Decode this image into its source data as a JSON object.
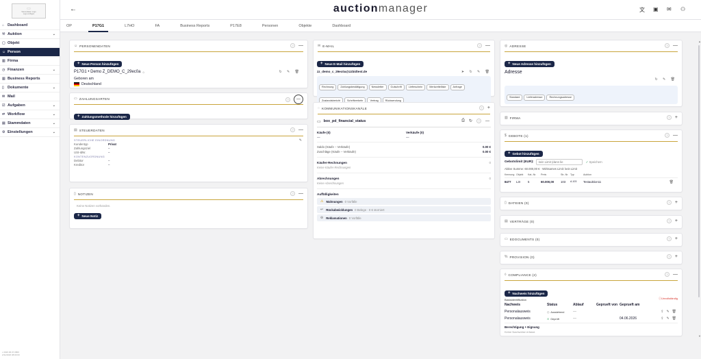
{
  "sidebar": {
    "logo_text": [
      "Stammdaten Logo",
      "Logo einfügen"
    ],
    "items": [
      {
        "label": "Dashboard",
        "icon": "home-icon",
        "chevron": false,
        "active": false
      },
      {
        "label": "Auktion",
        "icon": "gavel-icon",
        "chevron": true,
        "active": false
      },
      {
        "label": "Objekt",
        "icon": "box-icon",
        "chevron": false,
        "active": false
      },
      {
        "label": "Person",
        "icon": "person-icon",
        "chevron": false,
        "active": true
      },
      {
        "label": "Firma",
        "icon": "building-icon",
        "chevron": false,
        "active": false
      },
      {
        "label": "Finanzen",
        "icon": "finance-icon",
        "chevron": true,
        "active": false
      },
      {
        "label": "Business Reports",
        "icon": "chart-icon",
        "chevron": false,
        "active": false
      },
      {
        "label": "Dokumente",
        "icon": "document-icon",
        "chevron": true,
        "active": false
      },
      {
        "label": "Mail",
        "icon": "mail-icon",
        "chevron": false,
        "active": false
      },
      {
        "label": "Aufgaben",
        "icon": "task-icon",
        "chevron": true,
        "active": false
      },
      {
        "label": "Workflow",
        "icon": "workflow-icon",
        "chevron": true,
        "active": false
      },
      {
        "label": "Stammdaten",
        "icon": "database-icon",
        "chevron": true,
        "active": false
      },
      {
        "label": "Einstellungen",
        "icon": "gear-icon",
        "chevron": true,
        "active": false
      }
    ],
    "version": [
      "v 2026.06.07.0800",
      "2/11/2026 08:00:00"
    ]
  },
  "header": {
    "brand_bold": "auction",
    "brand_light": "manager"
  },
  "tabs": [
    "OP",
    "P17G1",
    "L7HO",
    "FA",
    "Business Reports",
    "P17E8",
    "Personen",
    "Objekte",
    "Dashboard"
  ],
  "active_tab": 1,
  "personendaten": {
    "title": "PERSONENDATEN",
    "button": "Neue Person hinzufügen",
    "name": "P17G1 • Demo Z_DEMO_C_29ec0a",
    "badge": "0",
    "born": "Geboren am",
    "country": "Deutschland"
  },
  "zahlungsarten": {
    "title": "ZAHLUNGSARTEN",
    "button": "Zahlungsmethode hinzufügen"
  },
  "steuerdaten": {
    "title": "STEUERDATEN",
    "section1": "STEUERLICHE EINORDNUNG",
    "rows1": [
      [
        "Kundentyp",
        "Privat"
      ],
      [
        "Zahlungsziel",
        "–"
      ],
      [
        "USt-IdNr.",
        "–"
      ]
    ],
    "section2": "KONTENZUORDNUNG",
    "rows2": [
      [
        "Debitor",
        "–"
      ],
      [
        "Kreditor",
        "–"
      ]
    ]
  },
  "notizen": {
    "title": "NOTIZEN",
    "empty": "Keine Notizen vorhanden.",
    "button": "Neue Notiz"
  },
  "email": {
    "title": "E-MAIL",
    "button": "Neue E-Mail hinzufügen",
    "address": "zz_demo_c_29ec0a@zzbidtest.de",
    "chips_row1": [
      "Rechnung",
      "Zahlungsbestätigung",
      "Newsletter",
      "Gutschrift",
      "Lieferschein",
      "Merkzettelliste",
      "Anfrage"
    ],
    "chips_row2": [
      "Zustandsbericht",
      "Schriftverkehr",
      "Vertrag",
      "Rücksendung"
    ]
  },
  "kommunikation": {
    "title": "KOMMUNIKATIONSKANÄLE"
  },
  "financial": {
    "title": "box_pd_financial_status",
    "kaeufe_label": "Käufe (0)",
    "verkaeufe_label": "Verkäufe (0)",
    "kaeufe_val": "—",
    "verkaeufe_val": "—",
    "saldo_label": "Saldo (Käufe − Verkäufe)",
    "saldo_val": "0.00 €",
    "zuschlaege_label": "Zuschläge (Käufe − Verkäufe)",
    "zuschlaege_val": "0.00 €",
    "kr_label": "Käufer-Rechnungen",
    "kr_count": "0",
    "kr_empty": "Keine Käufer-Rechnungen",
    "ab_label": "Abrechnungen",
    "ab_count": "0",
    "ab_empty": "Keine Abrechnungen",
    "auff_label": "Auffälligkeiten",
    "items": [
      {
        "label": "Mahnungen",
        "detail": "0 Vorfälle",
        "icon": "warning-icon"
      },
      {
        "label": "Rückabwicklungen",
        "detail": "0 Belege · 0 € storniert",
        "icon": "return-icon"
      },
      {
        "label": "Reklamationen",
        "detail": "0 Vorfälle",
        "icon": "complaint-icon"
      }
    ]
  },
  "adresse": {
    "title": "ADRESSE",
    "button": "Neue Adresse hinzufügen",
    "heading": "Adresse",
    "chips": [
      "Standard",
      "Lieferadresse",
      "Rechnungsadresse"
    ]
  },
  "firma": {
    "title": "FIRMA"
  },
  "gebote": {
    "title": "GEBOTE (1)",
    "button": "Gebot hinzufügen",
    "limit_label": "Gebotslimit (EUR):",
    "limit_placeholder": "kein Limit (dann lie",
    "save": "Speichern",
    "summary": "Aktive Summe: 60.000,00 € · Wirksames Limit: kein Limit",
    "cols": [
      "Kennung",
      "Objekt",
      "Kat.-Nr.",
      "Preis",
      "Str.-Nr.",
      "Typ",
      "Auktion"
    ],
    "row": [
      "8477",
      "L3I",
      "5",
      "60.000,00",
      "103",
      "A.103",
      "Testauktion11"
    ]
  },
  "dateien": {
    "title": "DATEIEN (0)"
  },
  "vertraege": {
    "title": "VERTRÄGE (0)"
  },
  "edocuments": {
    "title": "EDOCUMENTS (0)"
  },
  "provision": {
    "title": "PROVISION (0)"
  },
  "compliance": {
    "title": "COMPLIANCE (2)",
    "button": "Nachweis hinzufügen",
    "subtitle": "Basisidentifikation",
    "status_flag": "Unvollständig",
    "cols": [
      "Nachweis",
      "Status",
      "Ablauf",
      "Geprueft von",
      "Geprueft am"
    ],
    "rows": [
      {
        "name": "Personalausweis",
        "status": "Ausstehend",
        "ablauf": "—",
        "date": ""
      },
      {
        "name": "Personalausweis",
        "status": "Geprüft",
        "ablauf": "—",
        "date": "04.06.2026"
      }
    ],
    "section2": "Berechtigung + Eignung",
    "empty2": "Keine Nachweise erfasst."
  },
  "colors": {
    "navy": "#1b2748",
    "gold": "#c8a43a",
    "red": "#d9342b",
    "green": "#2e9e5b"
  }
}
